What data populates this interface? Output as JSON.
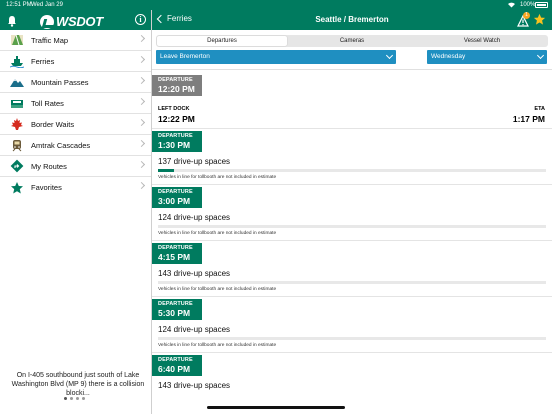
{
  "status_bar": {
    "time": "12:51 PM",
    "date": "Wed Jan 29",
    "battery": "100%"
  },
  "left_header": {
    "logo_text": "WSDOT"
  },
  "menu": [
    {
      "label": "Traffic Map",
      "icon": "traffic-map-icon"
    },
    {
      "label": "Ferries",
      "icon": "ferry-icon"
    },
    {
      "label": "Mountain Passes",
      "icon": "mountain-icon"
    },
    {
      "label": "Toll Rates",
      "icon": "toll-icon"
    },
    {
      "label": "Border Waits",
      "icon": "canada-leaf-icon"
    },
    {
      "label": "Amtrak Cascades",
      "icon": "amtrak-icon"
    },
    {
      "label": "My Routes",
      "icon": "route-icon"
    },
    {
      "label": "Favorites",
      "icon": "star-icon"
    }
  ],
  "alert": {
    "text": "On I-405 southbound just south of Lake Washington Blvd (MP 9) there is a collision blocki..."
  },
  "right_header": {
    "back_label": "Ferries",
    "title": "Seattle / Bremerton",
    "alert_count": "1"
  },
  "tabs": [
    {
      "label": "Departures",
      "active": true
    },
    {
      "label": "Cameras",
      "active": false
    },
    {
      "label": "Vessel Watch",
      "active": false
    }
  ],
  "selectors": {
    "direction": "Leave Bremerton",
    "day": "Wednesday"
  },
  "first_sailing": {
    "departure_label": "DEPARTURE",
    "departure_time": "12:20 PM",
    "left_dock_label": "LEFT DOCK",
    "left_dock_time": "12:22 PM",
    "eta_label": "ETA",
    "eta_time": "1:17 PM"
  },
  "sailings": [
    {
      "label": "DEPARTURE",
      "time": "1:30 PM",
      "spaces": "137 drive-up spaces",
      "fill": 0.04,
      "note": "Vehicles in line for tollbooth are not included in estimate"
    },
    {
      "label": "DEPARTURE",
      "time": "3:00 PM",
      "spaces": "124 drive-up spaces",
      "fill": 0,
      "note": "Vehicles in line for tollbooth are not included in estimate"
    },
    {
      "label": "DEPARTURE",
      "time": "4:15 PM",
      "spaces": "143 drive-up spaces",
      "fill": 0,
      "note": "Vehicles in line for tollbooth are not included in estimate"
    },
    {
      "label": "DEPARTURE",
      "time": "5:30 PM",
      "spaces": "124 drive-up spaces",
      "fill": 0,
      "note": "Vehicles in line for tollbooth are not included in estimate"
    },
    {
      "label": "DEPARTURE",
      "time": "6:40 PM",
      "spaces": "143 drive-up spaces",
      "fill": 0,
      "note": ""
    }
  ],
  "colors": {
    "brand_green": "#007b5f",
    "selector_blue": "#1f8fc1",
    "gray_tag": "#7e7e7e",
    "star_yellow": "#f7c21f",
    "alert_orange": "#f5a623"
  }
}
